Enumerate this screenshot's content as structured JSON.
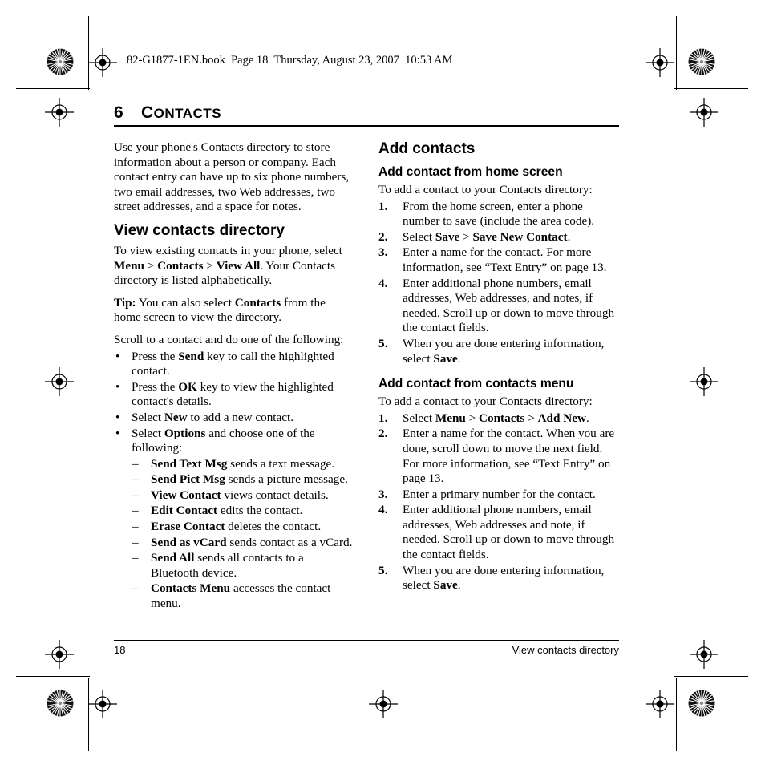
{
  "book_header": "82-G1877-1EN.book  Page 18  Thursday, August 23, 2007  10:53 AM",
  "chapter": {
    "number": "6",
    "title_first": "C",
    "title_rest": "ONTACTS",
    "title_full": "CONTACTS"
  },
  "left_column": {
    "intro": "Use your phone's Contacts directory to store information about a person or company. Each contact entry can have up to six phone numbers, two email addresses, two Web addresses, two street addresses, and a space for notes.",
    "section_title": "View contacts directory",
    "view_para_1a": "To view existing contacts in your phone, select ",
    "view_para_1b": "Menu",
    "view_para_1c": " > ",
    "view_para_1d": "Contacts",
    "view_para_1e": " > ",
    "view_para_1f": "View All",
    "view_para_1g": ". Your Contacts directory is listed alphabetically.",
    "tip_label": "Tip:",
    "tip_a": " You can also select ",
    "tip_b": "Contacts",
    "tip_c": " from the home screen to view the directory.",
    "scroll_para": "Scroll to a contact and do one of the following:",
    "bullets": [
      {
        "pre": "Press the ",
        "bold": "Send",
        "post": " key to call the highlighted contact."
      },
      {
        "pre": "Press the ",
        "bold": "OK",
        "post": " key to view the highlighted contact's details."
      },
      {
        "pre": "Select ",
        "bold": "New",
        "post": " to add a new contact."
      },
      {
        "pre": "Select ",
        "bold": "Options",
        "post": " and choose one of the following:"
      }
    ],
    "options": [
      {
        "bold": "Send Text Msg",
        "post": " sends a text message."
      },
      {
        "bold": "Send Pict Msg",
        "post": " sends a picture message."
      },
      {
        "bold": "View Contact",
        "post": " views contact details."
      },
      {
        "bold": "Edit Contact",
        "post": " edits the contact."
      },
      {
        "bold": "Erase Contact",
        "post": " deletes the contact."
      },
      {
        "bold": "Send as vCard",
        "post": " sends contact as a vCard."
      },
      {
        "bold": "Send All",
        "post": " sends all contacts to a Bluetooth device."
      },
      {
        "bold": "Contacts Menu",
        "post": " accesses the contact menu."
      }
    ],
    "bullet_glyph": "•",
    "dash_glyph": "–"
  },
  "right_column": {
    "section_title": "Add contacts",
    "sub1_title": "Add contact from home screen",
    "sub1_intro": "To add a contact to your Contacts directory:",
    "sub1_steps": [
      {
        "num": "1.",
        "pre": "From the home screen, enter a phone number to save (include the area code).",
        "bold": "",
        "post": ""
      },
      {
        "num": "2.",
        "pre": "Select ",
        "bold": "Save",
        "mid": " > ",
        "bold2": "Save New Contact",
        "post": "."
      },
      {
        "num": "3.",
        "pre": "Enter a name for the contact. For more information, see “Text Entry” on page 13.",
        "bold": "",
        "post": ""
      },
      {
        "num": "4.",
        "pre": "Enter additional phone numbers, email addresses, Web addresses, and notes, if needed. Scroll up or down to move through the contact fields.",
        "bold": "",
        "post": ""
      },
      {
        "num": "5.",
        "pre": "When you are done entering information, select ",
        "bold": "Save",
        "post": "."
      }
    ],
    "sub2_title": "Add contact from contacts menu",
    "sub2_intro": "To add a contact to your Contacts directory:",
    "sub2_steps": [
      {
        "num": "1.",
        "pre": "Select ",
        "bold": "Menu",
        "mid": " > ",
        "bold2": "Contacts",
        "mid2": " > ",
        "bold3": "Add New",
        "post": "."
      },
      {
        "num": "2.",
        "pre": "Enter a name for the contact. When you are done, scroll down to move the next field. For more information, see “Text Entry” on page 13.",
        "bold": "",
        "post": ""
      },
      {
        "num": "3.",
        "pre": "Enter a primary number for the contact.",
        "bold": "",
        "post": ""
      },
      {
        "num": "4.",
        "pre": "Enter additional phone numbers, email addresses, Web addresses and note, if needed. Scroll up or down to move through the contact fields.",
        "bold": "",
        "post": ""
      },
      {
        "num": "5.",
        "pre": "When you are done entering information, select ",
        "bold": "Save",
        "post": "."
      }
    ]
  },
  "footer": {
    "page_number": "18",
    "running_head": "View contacts directory"
  }
}
